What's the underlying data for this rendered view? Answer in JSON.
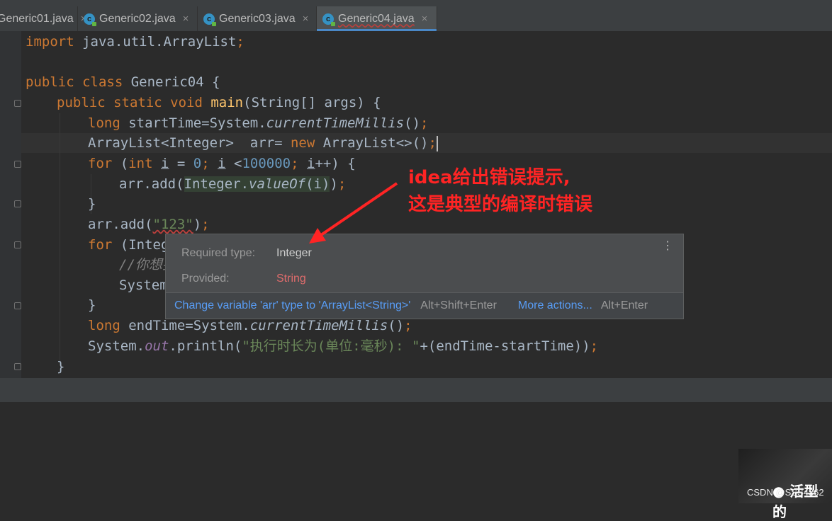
{
  "tabs": [
    {
      "label": "Generic01.java",
      "active": false
    },
    {
      "label": "Generic02.java",
      "active": false
    },
    {
      "label": "Generic03.java",
      "active": false
    },
    {
      "label": "Generic04.java",
      "active": true
    }
  ],
  "tab_close_glyph": "×",
  "code": {
    "l1_kw": "import",
    "l1_rest": " java.util.ArrayList",
    "l1_semi": ";",
    "l2_kw1": "public",
    "l2_kw2": "class",
    "l2_name": " Generic04 {",
    "l3_kw": "public static void",
    "l3_fn": "main",
    "l3_rest": "(String[] args) {",
    "l4_kw": "long",
    "l4_a": " startTime=System.",
    "l4_m": "currentTimeMillis",
    "l4_b": "()",
    "l4_semi": ";",
    "l5_a": "ArrayList<Integer>  arr= ",
    "l5_kw": "new",
    "l5_b": " ArrayList<>()",
    "l5_semi": ";",
    "l6_kw1": "for",
    "l6_a": " (",
    "l6_kw2": "int",
    "l6_i1": "i",
    "l6_b": " = ",
    "l6_n1": "0",
    "l6_s1": "; ",
    "l6_i2": "i",
    "l6_c": " <",
    "l6_n2": "100000",
    "l6_s2": "; ",
    "l6_i3": "i",
    "l6_d": "++) {",
    "l7_a": "arr.add(",
    "l7_h1": "Integer.",
    "l7_h2": "valueOf",
    "l7_h3": "(i)",
    "l7_b": ")",
    "l7_semi": ";",
    "l8": "}",
    "l9_a": "arr.add(",
    "l9_str": "\"123\"",
    "l9_b": ")",
    "l9_semi": ";",
    "l10_kw": "for",
    "l10_a": " (Integ",
    "l11_cmt": "//你想要",
    "l12": "System",
    "l13": "}",
    "l14_kw": "long",
    "l14_a": " endTime=System.",
    "l14_m": "currentTimeMillis",
    "l14_b": "()",
    "l14_semi": ";",
    "l15_a": "System.",
    "l15_f": "out",
    "l15_b": ".println(",
    "l15_str": "\"执行时长为(单位:毫秒): \"",
    "l15_c": "+(endTime-startTime))",
    "l15_semi": ";",
    "l16": "}"
  },
  "popup": {
    "required_label": "Required type:",
    "required_value": "Integer",
    "provided_label": "Provided:",
    "provided_value": "String",
    "menu_glyph": "⋮",
    "action1": "Change variable 'arr' type to 'ArrayList<String>'",
    "action1_key": "Alt+Shift+Enter",
    "action2": "More actions...",
    "action2_key": "Alt+Enter"
  },
  "annotation": {
    "line1": "idea给出错误提示,",
    "line2": "这是典型的编译时错误",
    "color": "#ff2424"
  },
  "watermark": {
    "text": "CSDN @SSS4362",
    "thumb_text": "● 活型的"
  },
  "colors": {
    "keyword": "#cc7832",
    "string": "#6a8759",
    "number": "#6897bb",
    "method": "#ffc66d",
    "error": "#e06c6c",
    "link": "#589df6"
  }
}
